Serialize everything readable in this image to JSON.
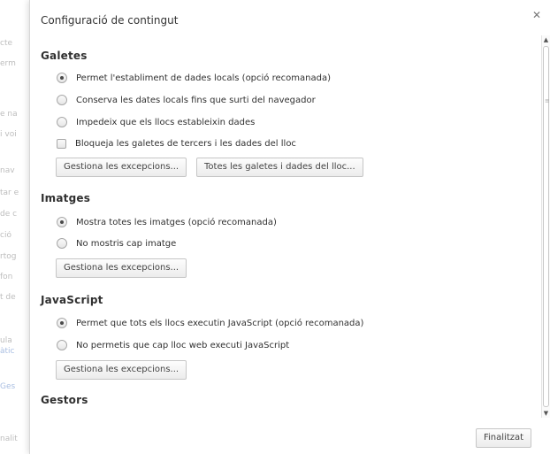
{
  "background_fragments": [
    {
      "text": "cte",
      "blue": false
    },
    {
      "text": "erm",
      "blue": false
    },
    {
      "text": "e na",
      "blue": false
    },
    {
      "text": "i voi",
      "blue": false
    },
    {
      "text": "nav",
      "blue": false
    },
    {
      "text": "tar e",
      "blue": false
    },
    {
      "text": "de c",
      "blue": false
    },
    {
      "text": "ció",
      "blue": false
    },
    {
      "text": "rtog",
      "blue": false
    },
    {
      "text": "fon",
      "blue": false
    },
    {
      "text": "t de",
      "blue": false
    },
    {
      "text": "ula",
      "blue": false
    },
    {
      "text": "àtic",
      "blue": true
    },
    {
      "text": "Ges",
      "blue": true
    },
    {
      "text": "nalit",
      "blue": false
    }
  ],
  "dialog": {
    "title": "Configuració de contingut",
    "close_icon": "close-icon",
    "done_label": "Finalitzat"
  },
  "sections": {
    "cookies": {
      "title": "Galetes",
      "options": [
        {
          "label": "Permet l'establiment de dades locals (opció recomanada)",
          "checked": true
        },
        {
          "label": "Conserva les dates locals fins que surti del navegador",
          "checked": false
        },
        {
          "label": "Impedeix que els llocs estableixin dades",
          "checked": false
        }
      ],
      "checkbox_label": "Bloqueja les galetes de tercers i les dades del lloc",
      "checkbox_checked": false,
      "exceptions_label": "Gestiona les excepcions...",
      "all_cookies_label": "Totes les galetes i dades del lloc..."
    },
    "images": {
      "title": "Imatges",
      "options": [
        {
          "label": "Mostra totes les imatges (opció recomanada)",
          "checked": true
        },
        {
          "label": "No mostris cap imatge",
          "checked": false
        }
      ],
      "exceptions_label": "Gestiona les excepcions..."
    },
    "javascript": {
      "title": "JavaScript",
      "options": [
        {
          "label": "Permet que tots els llocs executin JavaScript (opció recomanada)",
          "checked": true
        },
        {
          "label": "No permetis que cap lloc web executi JavaScript",
          "checked": false
        }
      ],
      "exceptions_label": "Gestiona les excepcions..."
    },
    "handlers": {
      "title": "Gestors"
    }
  }
}
